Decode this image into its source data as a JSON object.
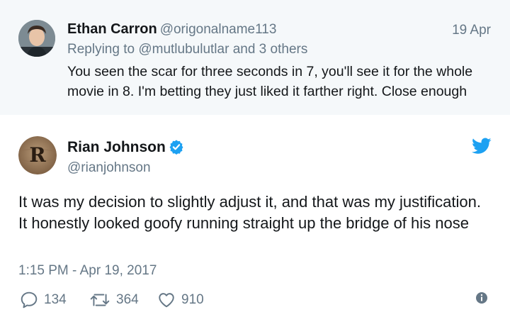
{
  "reply": {
    "name": "Ethan Carron",
    "handle": "@origonalname113",
    "date": "19 Apr",
    "replying_prefix": "Replying to",
    "replying_mention": "@mutlubulutlar",
    "replying_suffix": "and 3 others",
    "text": "You seen the scar for three seconds in 7, you'll see it for the whole movie in 8. I'm betting they just liked it farther right. Close enough"
  },
  "tweet": {
    "name": "Rian Johnson",
    "handle": "@rianjohnson",
    "avatar_letter": "R",
    "text": "It was my decision to slightly adjust it, and that was my justification. It honestly looked goofy running straight up the bridge of his nose",
    "timestamp": "1:15 PM - Apr 19, 2017",
    "reply_count": "134",
    "retweet_count": "364",
    "like_count": "910"
  },
  "icons": {
    "reply": "reply-icon",
    "retweet": "retweet-icon",
    "like": "heart-icon",
    "info": "info-icon",
    "brand": "twitter-bird-icon",
    "verified": "verified-badge-icon"
  },
  "colors": {
    "twitter_blue": "#1da1f2",
    "secondary_text": "#657786",
    "reply_background": "#f5f8fa"
  }
}
